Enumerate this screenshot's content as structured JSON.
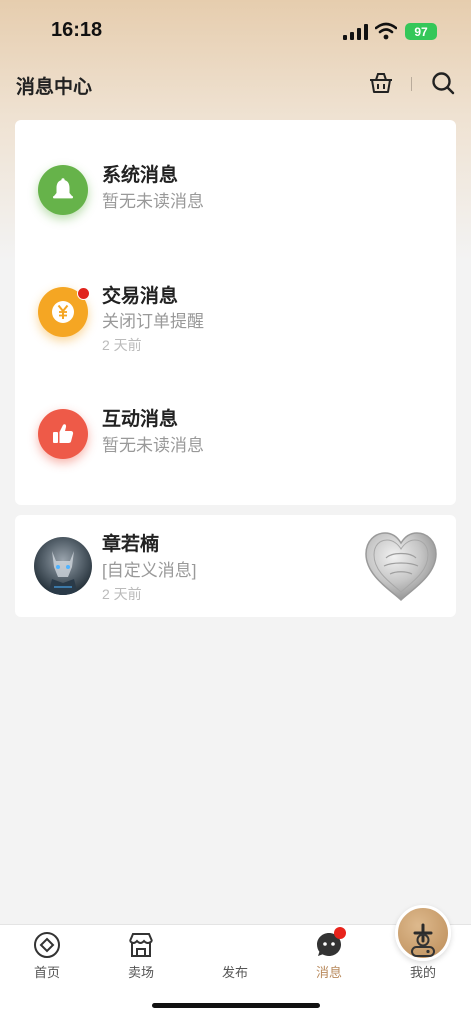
{
  "status_bar": {
    "time": "16:18",
    "battery": "97"
  },
  "header": {
    "title": "消息中心",
    "shop_icon": "basket-icon",
    "search_icon": "search-icon"
  },
  "system_messages": [
    {
      "icon": "bell-icon",
      "color": "#66b34a",
      "title": "系统消息",
      "subtitle": "暂无未读消息",
      "time": ""
    },
    {
      "icon": "yuan-icon",
      "color": "#f5a623",
      "title": "交易消息",
      "subtitle": "关闭订单提醒",
      "time": "2 天前",
      "unread_dot": true
    },
    {
      "icon": "thumbs-up-icon",
      "color": "#ee5a48",
      "title": "互动消息",
      "subtitle": "暂无未读消息",
      "time": ""
    }
  ],
  "conversation": {
    "name": "章若楠",
    "preview": "[自定义消息]",
    "time": "2 天前"
  },
  "tabbar": {
    "items": [
      {
        "label": "首页",
        "icon": "home-icon"
      },
      {
        "label": "卖场",
        "icon": "store-icon"
      },
      {
        "label": "发布",
        "icon": "plus-icon"
      },
      {
        "label": "消息",
        "icon": "message-icon",
        "active": true,
        "badge": true
      },
      {
        "label": "我的",
        "icon": "profile-icon"
      }
    ],
    "active_color": "#b8895b"
  }
}
